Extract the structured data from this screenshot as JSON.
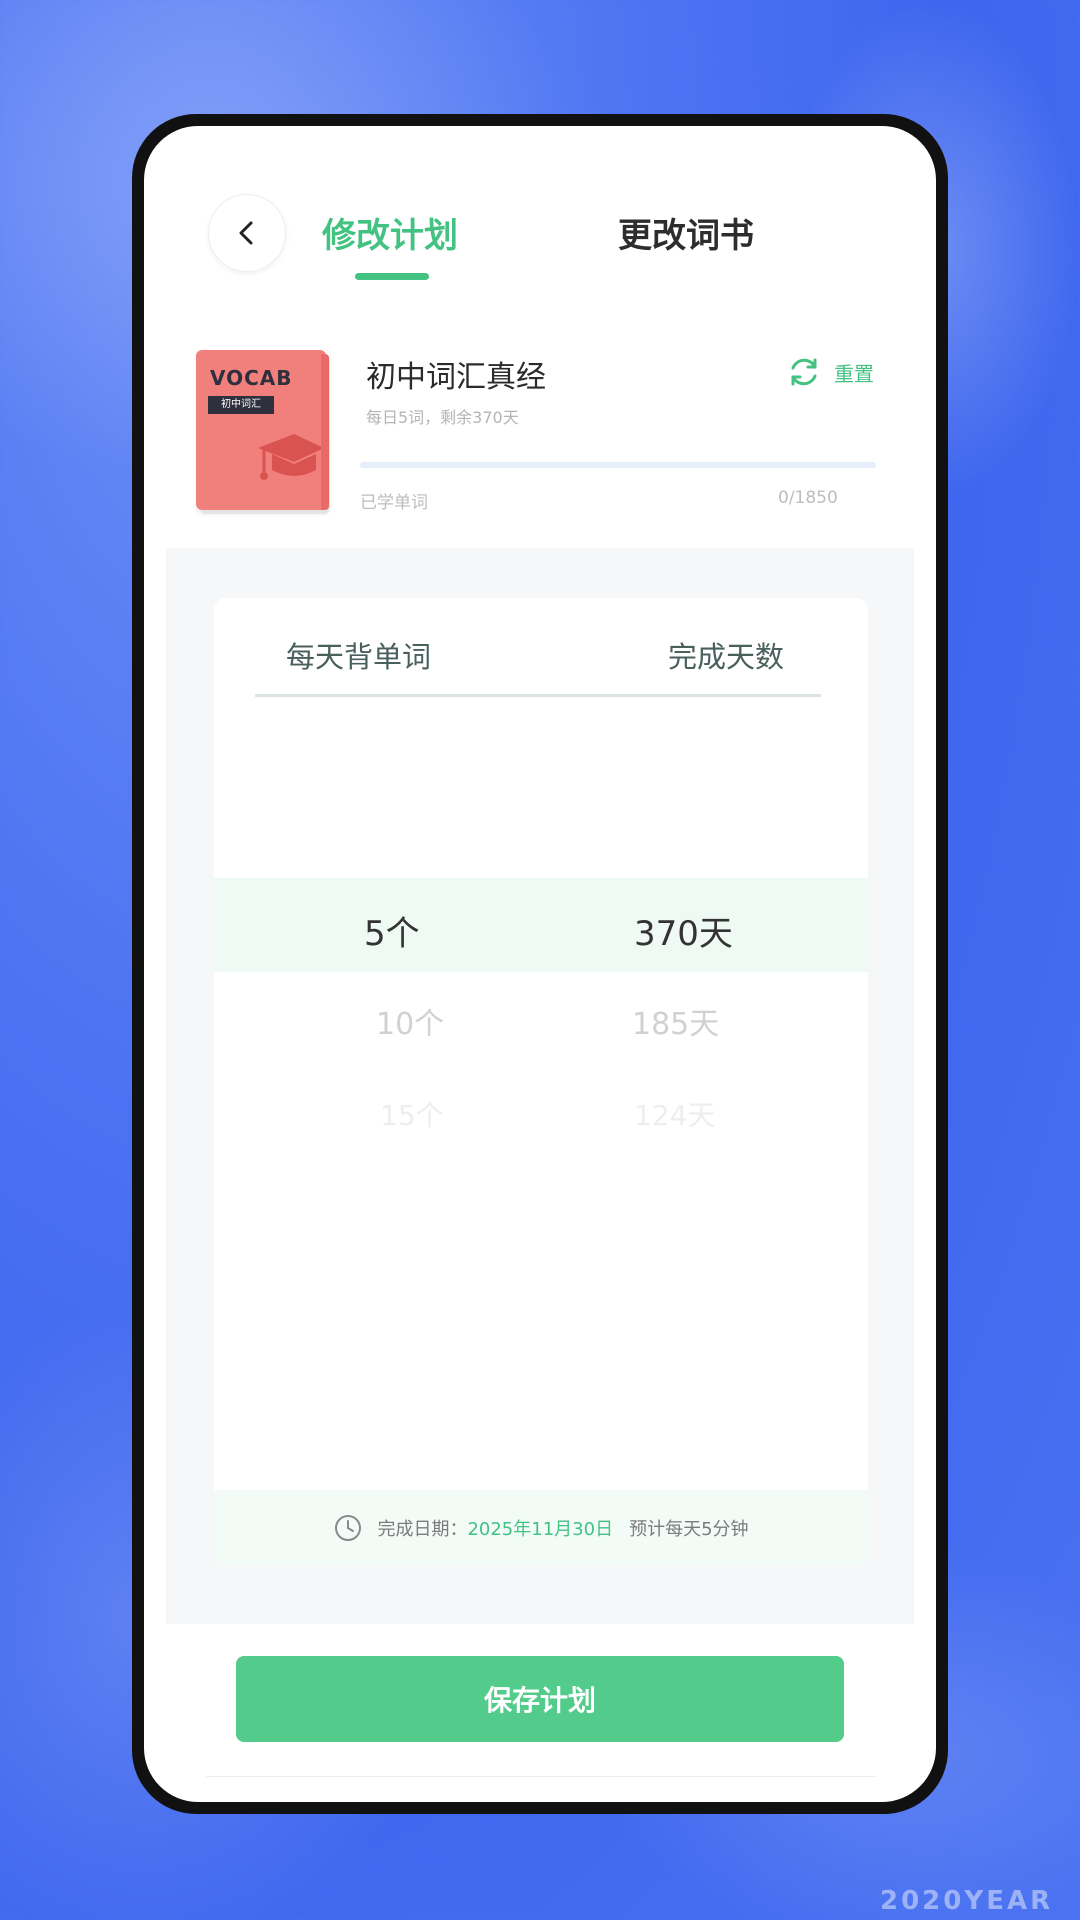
{
  "header": {
    "tab_plan": "修改计划",
    "tab_book": "更改词书"
  },
  "book": {
    "cover_title": "VOCAB",
    "cover_tag": "初中词汇",
    "title": "初中词汇真经",
    "subtitle": "每日5词，剩余370天",
    "reset_label": "重置",
    "progress": 0,
    "learned_label": "已学单词",
    "learned_count": "0/1850"
  },
  "picker": {
    "words_header": "每天背单词",
    "days_header": "完成天数",
    "options": [
      {
        "words": "5个",
        "days": "370天"
      },
      {
        "words": "10个",
        "days": "185天"
      },
      {
        "words": "15个",
        "days": "124天"
      }
    ],
    "selected_index": 0
  },
  "summary": {
    "label": "完成日期：",
    "date": "2025年11月30日",
    "daily_time": "预计每天5分钟"
  },
  "save_label": "保存计划",
  "watermark": "2020YEAR",
  "colors": {
    "accent": "#43c282",
    "button": "#52cb8b",
    "book_cover": "#f1807d",
    "background": "#4d74f2"
  },
  "icons": {
    "back": "chevron-left-icon",
    "reset": "refresh-icon",
    "clock": "clock-icon",
    "cover": "graduation-cap-icon"
  }
}
